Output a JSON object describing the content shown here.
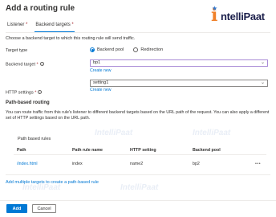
{
  "dialog": {
    "title": "Add a routing rule"
  },
  "brand": {
    "logo_mark": "i",
    "logo_word": "ntelliPaat",
    "logo_color": "#f0812a",
    "logo_text_color": "#1b1f4b"
  },
  "tabs": [
    {
      "label": "Listener",
      "required": "*"
    },
    {
      "label": "Backend targets",
      "required": "*"
    }
  ],
  "description": "Choose a backend target to which this routing rule will send traffic.",
  "form": {
    "target_type": {
      "label": "Target type",
      "options": [
        "Backend pool",
        "Redirection"
      ],
      "selected": "Backend pool"
    },
    "backend_target": {
      "label": "Backend target",
      "required": "*",
      "value": "bp1",
      "create_new": "Create new"
    },
    "http_settings": {
      "label": "HTTP settings",
      "required": "*",
      "value": "setting1",
      "create_new": "Create new"
    }
  },
  "path_routing": {
    "heading": "Path-based routing",
    "paragraph": "You can route traffic from this rule's listener to different backend targets based on the URL path of the request. You can also apply a different set of HTTP settings based on the URL path.",
    "rules_label": "Path based rules",
    "columns": [
      "Path",
      "Path rule name",
      "HTTP setting",
      "Backend pool"
    ],
    "rows": [
      {
        "path": "/index.html",
        "name": "index",
        "setting": "name2",
        "pool": "bp2",
        "more": "•••"
      }
    ],
    "add_link": "Add multiple targets to create a path-based rule"
  },
  "watermark": "IntelliPaat",
  "footer": {
    "add": "Add",
    "cancel": "Cancel"
  },
  "colors": {
    "accent": "#0078d4",
    "required": "#a4262c"
  }
}
